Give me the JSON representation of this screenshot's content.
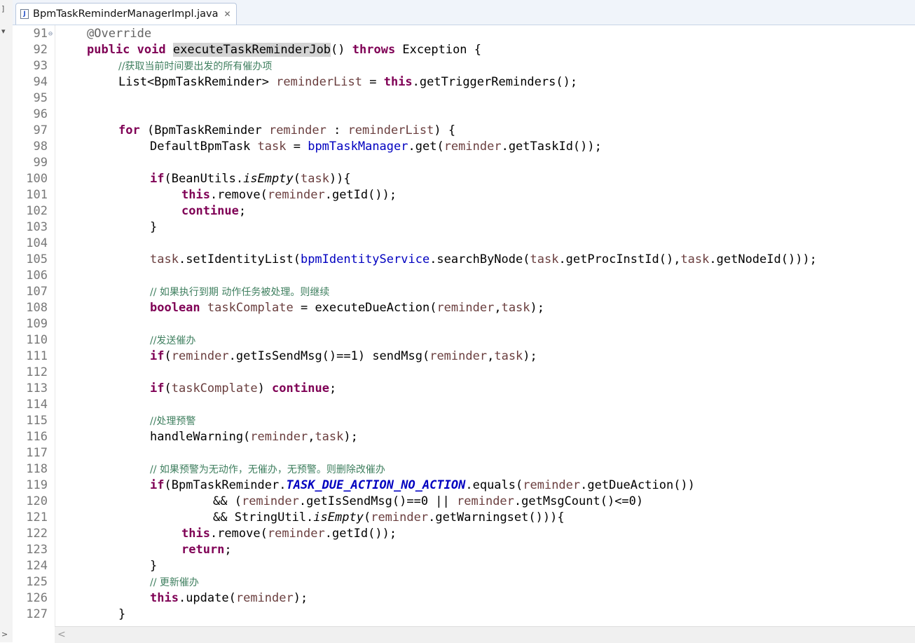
{
  "tab": {
    "title": "BpmTaskReminderManagerImpl.java",
    "close": "✕",
    "file_icon": "J"
  },
  "rail": {
    "top_mark": "]",
    "collapse_mark": "▾",
    "bottom_mark": ">"
  },
  "gutter": {
    "override_marker": "△",
    "fold_marker": "⊖"
  },
  "lines": [
    {
      "n": "91",
      "indent": 0,
      "tokens": [
        {
          "t": "@Override",
          "c": "ann"
        }
      ]
    },
    {
      "n": "92",
      "indent": 0,
      "tokens": [
        {
          "t": "public",
          "c": "kw"
        },
        {
          "t": " "
        },
        {
          "t": "void",
          "c": "kw"
        },
        {
          "t": " "
        },
        {
          "t": "executeTaskReminderJob",
          "c": "hl"
        },
        {
          "t": "() "
        },
        {
          "t": "throws",
          "c": "kw"
        },
        {
          "t": " Exception {"
        }
      ]
    },
    {
      "n": "93",
      "indent": 1,
      "tokens": [
        {
          "t": "//获取当前时间要出发的所有催办项",
          "c": "cm"
        }
      ]
    },
    {
      "n": "94",
      "indent": 1,
      "tokens": [
        {
          "t": "List<BpmTaskReminder> "
        },
        {
          "t": "reminderList",
          "c": "var"
        },
        {
          "t": " = "
        },
        {
          "t": "this",
          "c": "kw"
        },
        {
          "t": ".getTriggerReminders();"
        }
      ]
    },
    {
      "n": "95",
      "indent": 0,
      "tokens": []
    },
    {
      "n": "96",
      "indent": 0,
      "tokens": []
    },
    {
      "n": "97",
      "indent": 1,
      "tokens": [
        {
          "t": "for",
          "c": "kw"
        },
        {
          "t": " (BpmTaskReminder "
        },
        {
          "t": "reminder",
          "c": "var"
        },
        {
          "t": " : "
        },
        {
          "t": "reminderList",
          "c": "var"
        },
        {
          "t": ") {"
        }
      ]
    },
    {
      "n": "98",
      "indent": 2,
      "tokens": [
        {
          "t": "DefaultBpmTask "
        },
        {
          "t": "task",
          "c": "var"
        },
        {
          "t": " = "
        },
        {
          "t": "bpmTaskManager",
          "c": "fld"
        },
        {
          "t": ".get("
        },
        {
          "t": "reminder",
          "c": "var"
        },
        {
          "t": ".getTaskId());"
        }
      ]
    },
    {
      "n": "99",
      "indent": 0,
      "tokens": []
    },
    {
      "n": "100",
      "indent": 2,
      "tokens": [
        {
          "t": "if",
          "c": "kw"
        },
        {
          "t": "(BeanUtils."
        },
        {
          "t": "isEmpty",
          "c": "it"
        },
        {
          "t": "("
        },
        {
          "t": "task",
          "c": "var"
        },
        {
          "t": ")){"
        }
      ]
    },
    {
      "n": "101",
      "indent": 3,
      "tokens": [
        {
          "t": "this",
          "c": "kw"
        },
        {
          "t": ".remove("
        },
        {
          "t": "reminder",
          "c": "var"
        },
        {
          "t": ".getId());"
        }
      ]
    },
    {
      "n": "102",
      "indent": 3,
      "tokens": [
        {
          "t": "continue",
          "c": "kw"
        },
        {
          "t": ";"
        }
      ]
    },
    {
      "n": "103",
      "indent": 2,
      "tokens": [
        {
          "t": "}"
        }
      ]
    },
    {
      "n": "104",
      "indent": 0,
      "tokens": []
    },
    {
      "n": "105",
      "indent": 2,
      "tokens": [
        {
          "t": "task",
          "c": "var"
        },
        {
          "t": ".setIdentityList("
        },
        {
          "t": "bpmIdentityService",
          "c": "fld"
        },
        {
          "t": ".searchByNode("
        },
        {
          "t": "task",
          "c": "var"
        },
        {
          "t": ".getProcInstId(),"
        },
        {
          "t": "task",
          "c": "var"
        },
        {
          "t": ".getNodeId()));"
        }
      ]
    },
    {
      "n": "106",
      "indent": 0,
      "tokens": []
    },
    {
      "n": "107",
      "indent": 2,
      "tokens": [
        {
          "t": "// 如果执行到期 动作任务被处理。则继续",
          "c": "cm"
        }
      ]
    },
    {
      "n": "108",
      "indent": 2,
      "tokens": [
        {
          "t": "boolean",
          "c": "kw"
        },
        {
          "t": " "
        },
        {
          "t": "taskComplate",
          "c": "var"
        },
        {
          "t": " = executeDueAction("
        },
        {
          "t": "reminder",
          "c": "var"
        },
        {
          "t": ","
        },
        {
          "t": "task",
          "c": "var"
        },
        {
          "t": ");"
        }
      ]
    },
    {
      "n": "109",
      "indent": 0,
      "tokens": []
    },
    {
      "n": "110",
      "indent": 2,
      "tokens": [
        {
          "t": "//发送催办",
          "c": "cm"
        }
      ]
    },
    {
      "n": "111",
      "indent": 2,
      "tokens": [
        {
          "t": "if",
          "c": "kw"
        },
        {
          "t": "("
        },
        {
          "t": "reminder",
          "c": "var"
        },
        {
          "t": ".getIsSendMsg()==1) sendMsg("
        },
        {
          "t": "reminder",
          "c": "var"
        },
        {
          "t": ","
        },
        {
          "t": "task",
          "c": "var"
        },
        {
          "t": ");"
        }
      ]
    },
    {
      "n": "112",
      "indent": 0,
      "tokens": []
    },
    {
      "n": "113",
      "indent": 2,
      "tokens": [
        {
          "t": "if",
          "c": "kw"
        },
        {
          "t": "("
        },
        {
          "t": "taskComplate",
          "c": "var"
        },
        {
          "t": ") "
        },
        {
          "t": "continue",
          "c": "kw"
        },
        {
          "t": ";"
        }
      ]
    },
    {
      "n": "114",
      "indent": 0,
      "tokens": []
    },
    {
      "n": "115",
      "indent": 2,
      "tokens": [
        {
          "t": "//处理预警",
          "c": "cm"
        }
      ]
    },
    {
      "n": "116",
      "indent": 2,
      "tokens": [
        {
          "t": "handleWarning("
        },
        {
          "t": "reminder",
          "c": "var"
        },
        {
          "t": ","
        },
        {
          "t": "task",
          "c": "var"
        },
        {
          "t": ");"
        }
      ]
    },
    {
      "n": "117",
      "indent": 0,
      "tokens": []
    },
    {
      "n": "118",
      "indent": 2,
      "tokens": [
        {
          "t": "// 如果预警为无动作，无催办，无预警。则删除改催办",
          "c": "cm"
        }
      ]
    },
    {
      "n": "119",
      "indent": 2,
      "tokens": [
        {
          "t": "if",
          "c": "kw"
        },
        {
          "t": "(BpmTaskReminder."
        },
        {
          "t": "TASK_DUE_ACTION_NO_ACTION",
          "c": "const"
        },
        {
          "t": ".equals("
        },
        {
          "t": "reminder",
          "c": "var"
        },
        {
          "t": ".getDueAction())"
        }
      ]
    },
    {
      "n": "120",
      "indent": 4,
      "tokens": [
        {
          "t": "&& ("
        },
        {
          "t": "reminder",
          "c": "var"
        },
        {
          "t": ".getIsSendMsg()==0 || "
        },
        {
          "t": "reminder",
          "c": "var"
        },
        {
          "t": ".getMsgCount()<=0)"
        }
      ]
    },
    {
      "n": "121",
      "indent": 4,
      "tokens": [
        {
          "t": "&& StringUtil."
        },
        {
          "t": "isEmpty",
          "c": "it"
        },
        {
          "t": "("
        },
        {
          "t": "reminder",
          "c": "var"
        },
        {
          "t": ".getWarningset())){"
        }
      ]
    },
    {
      "n": "122",
      "indent": 3,
      "tokens": [
        {
          "t": "this",
          "c": "kw"
        },
        {
          "t": ".remove("
        },
        {
          "t": "reminder",
          "c": "var"
        },
        {
          "t": ".getId());"
        }
      ]
    },
    {
      "n": "123",
      "indent": 3,
      "tokens": [
        {
          "t": "return",
          "c": "kw"
        },
        {
          "t": ";"
        }
      ]
    },
    {
      "n": "124",
      "indent": 2,
      "tokens": [
        {
          "t": "}"
        }
      ]
    },
    {
      "n": "125",
      "indent": 2,
      "tokens": [
        {
          "t": "// 更新催办",
          "c": "cm"
        }
      ]
    },
    {
      "n": "126",
      "indent": 2,
      "tokens": [
        {
          "t": "this",
          "c": "kw"
        },
        {
          "t": ".update("
        },
        {
          "t": "reminder",
          "c": "var"
        },
        {
          "t": ");"
        }
      ]
    },
    {
      "n": "127",
      "indent": 1,
      "tokens": [
        {
          "t": "}"
        }
      ]
    }
  ],
  "scrollbar": {
    "left_arrow": "<"
  }
}
